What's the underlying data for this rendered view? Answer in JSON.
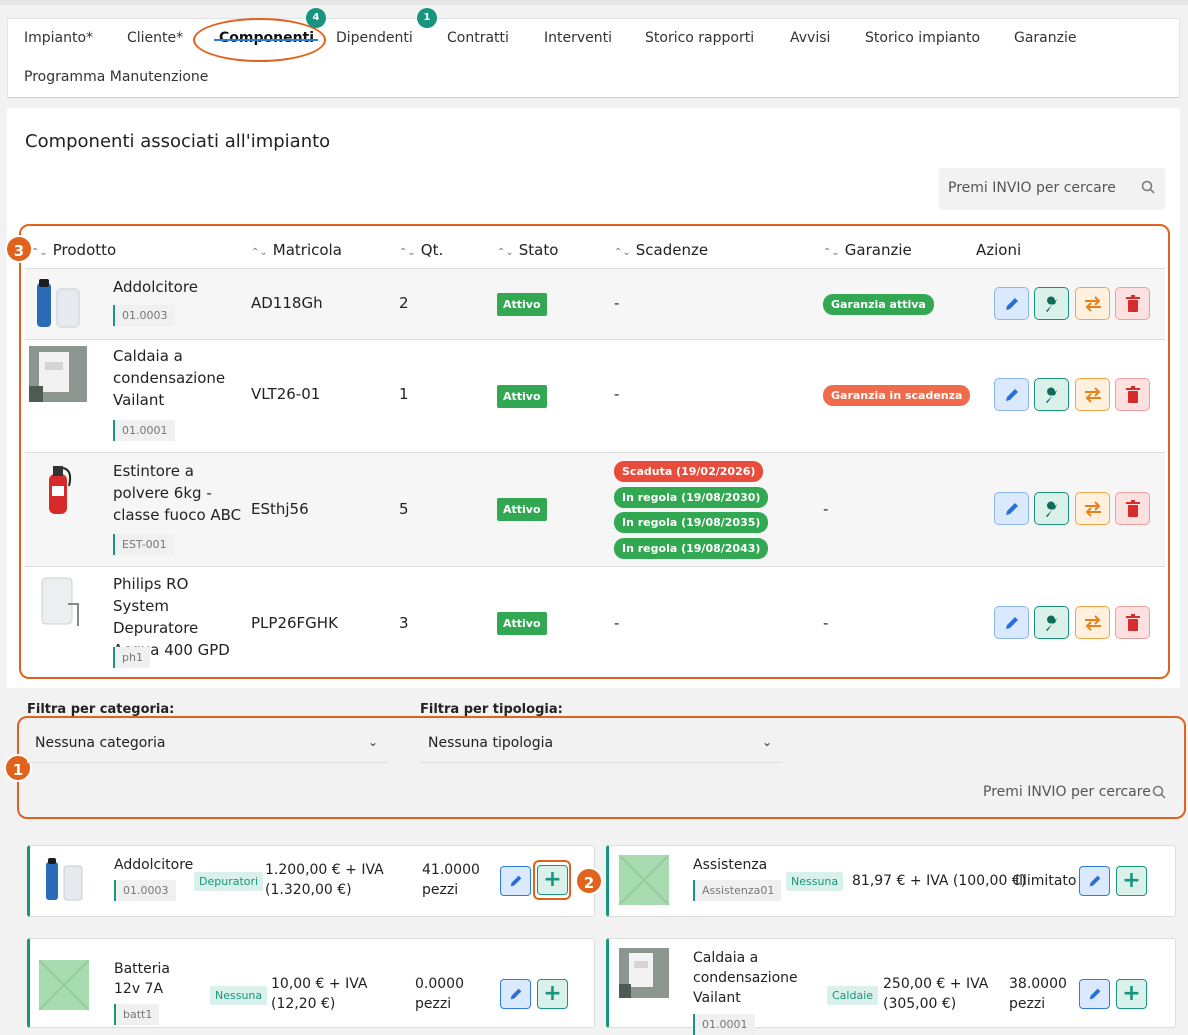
{
  "tabs": [
    {
      "label": "Impianto*"
    },
    {
      "label": "Cliente*"
    },
    {
      "label": "Componenti",
      "badge": "4"
    },
    {
      "label": "Dipendenti",
      "badge": "1"
    },
    {
      "label": "Contratti"
    },
    {
      "label": "Interventi"
    },
    {
      "label": "Storico rapporti"
    },
    {
      "label": "Avvisi"
    },
    {
      "label": "Storico impianto"
    },
    {
      "label": "Garanzie"
    },
    {
      "label": "Programma Manutenzione"
    }
  ],
  "page_title": "Componenti associati all'impianto",
  "search_placeholder": "Premi INVIO per cercare",
  "table": {
    "headers": [
      "Prodotto",
      "Matricola",
      "Qt.",
      "Stato",
      "Scadenze",
      "Garanzie",
      "Azioni"
    ],
    "rows": [
      {
        "name": "Addolcitore",
        "code": "01.0003",
        "matricola": "AD118Gh",
        "qty": "2",
        "stato": "Attivo",
        "scadenze": "-",
        "garanzia": "Garanzia attiva"
      },
      {
        "name": "Caldaia a condensazione Vailant",
        "code": "01.0001",
        "matricola": "VLT26-01",
        "qty": "1",
        "stato": "Attivo",
        "scadenze": "-",
        "garanzia": "Garanzia in scadenza"
      },
      {
        "name": "Estintore a polvere 6kg - classe fuoco ABC",
        "code": "EST-001",
        "matricola": "ESthj56",
        "qty": "5",
        "stato": "Attivo",
        "scadenze_list": [
          "Scaduta (19/02/2026)",
          "In regola (19/08/2030)",
          "In regola (19/08/2035)",
          "In regola (19/08/2043)"
        ],
        "garanzia": "-"
      },
      {
        "name": "Philips RO System Depuratore Acqua 400 GPD",
        "code": "ph1",
        "matricola": "PLP26FGHK",
        "qty": "3",
        "stato": "Attivo",
        "scadenze": "-",
        "garanzia": "-"
      }
    ]
  },
  "filters": {
    "category_label": "Filtra per categoria:",
    "category_value": "Nessuna categoria",
    "type_label": "Filtra per tipologia:",
    "type_value": "Nessuna tipologia",
    "search_placeholder": "Premi INVIO per cercare"
  },
  "products": [
    {
      "name": "Addolcitore",
      "code": "01.0003",
      "category": "Depuratori",
      "price": "1.200,00 € + IVA",
      "price_gross": "(1.320,00 €)",
      "stock": "41.0000",
      "unit": "pezzi"
    },
    {
      "name": "Assistenza",
      "code": "Assistenza01",
      "category": "Nessuna",
      "price": "81,97 € + IVA (100,00 €)",
      "stock": "Illimitato"
    },
    {
      "name": "Batteria 12v 7A",
      "code": "batt1",
      "category": "Nessuna",
      "price": "10,00 € + IVA",
      "price_gross": "(12,20 €)",
      "stock": "0.0000",
      "unit": "pezzi"
    },
    {
      "name": "Caldaia a condensazione Vailant",
      "code": "01.0001",
      "category": "Caldaie",
      "price": "250,00 € + IVA",
      "price_gross": "(305,00 €)",
      "stock": "38.0000",
      "unit": "pezzi"
    }
  ],
  "callouts": [
    "1",
    "2",
    "3"
  ],
  "colors": {
    "accent": "#17957f",
    "annotation": "#e0621c",
    "active_tab_underline": "#2a7fd4",
    "expired": "#e74c3c",
    "ok": "#32a852",
    "expiring": "#ef6b4c"
  }
}
